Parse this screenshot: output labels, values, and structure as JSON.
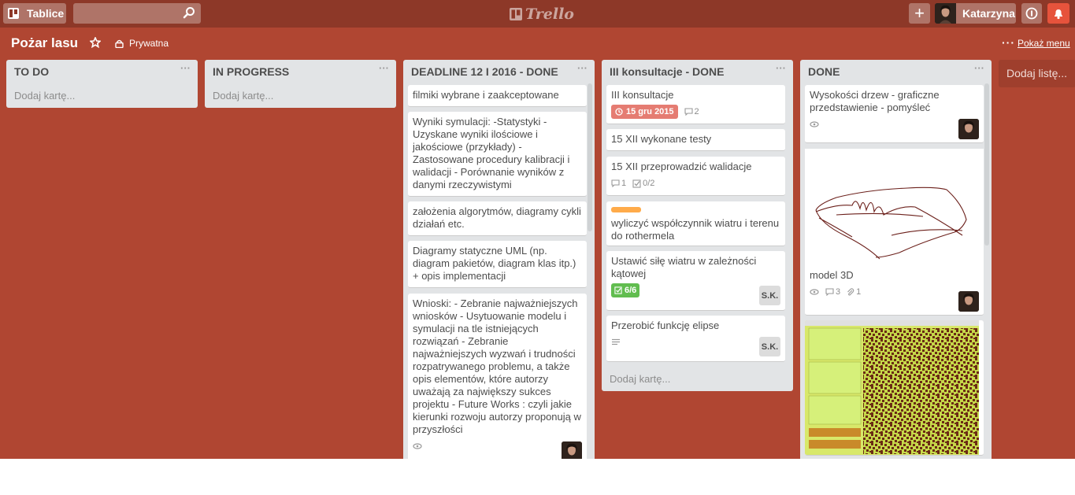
{
  "header": {
    "boards_label": "Tablice",
    "search_placeholder": "",
    "logo_text": "Trello",
    "add_label": "+",
    "member_name": "Katarzyna"
  },
  "board": {
    "title": "Pożar lasu",
    "visibility": "Prywatna",
    "menu_dots": "···",
    "show_menu": "Pokaż menu"
  },
  "lists": [
    {
      "title": "TO DO",
      "add_card": "Dodaj kartę..."
    },
    {
      "title": "IN PROGRESS",
      "add_card": "Dodaj kartę..."
    },
    {
      "title": "DEADLINE 12 I 2016 - DONE",
      "cards": [
        {
          "text": "filmiki wybrane i zaakceptowane"
        },
        {
          "text": "Wyniki symulacji: -Statystyki - Uzyskane wyniki ilościowe i jakościowe (przykłady) - Zastosowane procedury kalibracji i walidacji - Porównanie wyników z danymi rzeczywistymi"
        },
        {
          "text": "założenia algorytmów, diagramy cykli działań etc."
        },
        {
          "text": "Diagramy statyczne UML (np. diagram pakietów, diagram klas itp.) + opis implementacji"
        },
        {
          "text": "Wnioski: - Zebranie najważniejszych wniosków - Usytuowanie modelu i symulacji na tle istniejących rozwiązań - Zebranie najważniejszych wyzwań i trudności rozpatrywanego problemu, a także opis elementów, które autorzy uważają za największy sukces projektu - Future Works : czyli jakie kierunki rozwoju autorzy proponują w przyszłości"
        }
      ]
    },
    {
      "title": "III konsultacje - DONE",
      "add_card": "Dodaj kartę...",
      "cards": [
        {
          "text": "III konsultacje",
          "due": "15 gru 2015",
          "comments": "2"
        },
        {
          "text": "15 XII wykonane testy"
        },
        {
          "text": "15 XII przeprowadzić walidacje",
          "comments": "1",
          "checklist": "0/2"
        },
        {
          "text": "wyliczyć współczynnik wiatru i terenu do rothermela"
        },
        {
          "text": "Ustawić siłę wiatru w zależności kątowej",
          "checklist": "6/6",
          "member": "S.K."
        },
        {
          "text": "Przerobić funkcję elipse",
          "member": "S.K."
        }
      ]
    },
    {
      "title": "DONE",
      "cards": [
        {
          "text": "Wysokości drzew - graficzne przedstawienie - pomyśleć"
        },
        {
          "text": "model 3D",
          "comments": "3",
          "attachments": "1"
        }
      ]
    }
  ],
  "add_list": "Dodaj listę...",
  "colors": {
    "board_bg": "#b04632",
    "header_bg": "#8d3828",
    "list_bg": "#e2e4e6",
    "due_red": "#e57c72",
    "done_green": "#61bd4f",
    "label_orange": "#ffab4a"
  }
}
